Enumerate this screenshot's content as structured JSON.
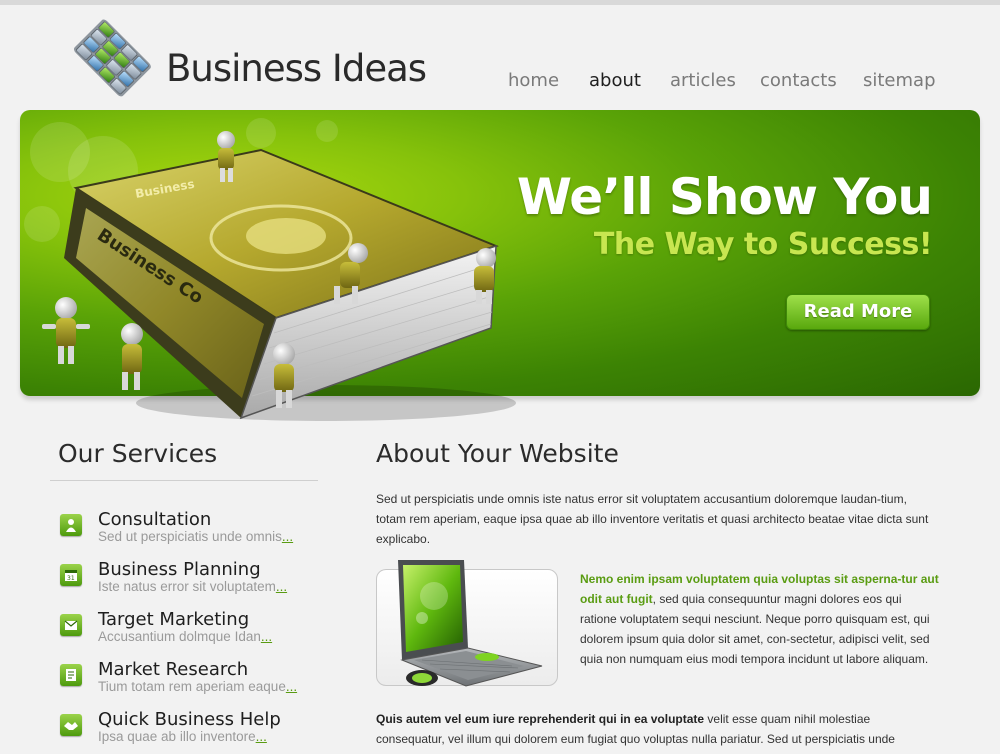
{
  "header": {
    "logo_text": "Business Ideas",
    "nav": [
      {
        "label": "home",
        "active": false
      },
      {
        "label": "about",
        "active": true
      },
      {
        "label": "articles",
        "active": false
      },
      {
        "label": "contacts",
        "active": false
      },
      {
        "label": "sitemap",
        "active": false
      }
    ]
  },
  "banner": {
    "headline": "We’ll Show You",
    "subheadline": "The Way to Success!",
    "button_label": "Read More",
    "book_text_1": "Business",
    "book_text_2": "Business Co"
  },
  "services": {
    "title": "Our Services",
    "more_label": "...",
    "items": [
      {
        "title": "Consultation",
        "desc": "Sed ut perspiciatis unde omnis",
        "icon": "person-icon"
      },
      {
        "title": "Business Planning",
        "desc": "Iste natus error sit voluptatem",
        "icon": "calendar-icon"
      },
      {
        "title": "Target Marketing",
        "desc": "Accusantium dolmque Idan",
        "icon": "email-icon"
      },
      {
        "title": "Market Research",
        "desc": "Tium totam rem aperiam eaque",
        "icon": "document-icon"
      },
      {
        "title": "Quick Business Help",
        "desc": "Ipsa quae ab illo inventore",
        "icon": "handshake-icon"
      }
    ]
  },
  "about": {
    "title": "About Your Website",
    "p1": "Sed ut perspiciatis unde omnis iste natus error sit voluptatem accusantium doloremque laudan-tium, totam rem aperiam, eaque ipsa quae ab illo inventore veritatis et quasi architecto beatae vitae dicta sunt explicabo.",
    "p2_bold": "Nemo enim ipsam voluptatem quia voluptas sit asperna-tur aut odit aut fugit",
    "p2_rest": ", sed quia consequuntur magni dolores eos qui ratione voluptatem sequi nesciunt. Neque porro quisquam est, qui dolorem ipsum quia dolor sit amet, con-sectetur, adipisci velit, sed quia non numquam eius modi tempora incidunt ut labore aliquam.",
    "p3_bold": "Quis autem vel eum iure reprehenderit qui in ea voluptate",
    "p3_rest": " velit esse quam nihil molestiae consequatur, vel illum qui dolorem eum fugiat quo voluptas nulla pariatur. Sed ut perspiciatis unde"
  },
  "colors": {
    "accent_green": "#5a9c12",
    "banner_dark": "#2a6702",
    "banner_light": "#a8d80f",
    "subheadline": "#c8e650"
  }
}
